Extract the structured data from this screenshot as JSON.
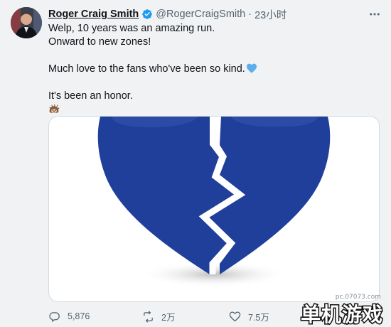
{
  "tweet": {
    "author": {
      "display_name": "Roger Craig Smith",
      "handle": "@RogerCraigSmith",
      "separator": "·",
      "time": "23小时",
      "verified": true
    },
    "more_icon": "more-horizontal-icon",
    "lines": [
      "Welp, 10 years was an amazing run.",
      "Onward to new zones!",
      "",
      "Much love to the fans who've been so kind.",
      "",
      "It's been an honor."
    ],
    "emoji_end": "hedgehog",
    "media": {
      "description_icon": "broken-heart-image",
      "heart_color": "#1f3f9a"
    },
    "actions": {
      "reply": {
        "icon": "reply-icon",
        "count": "5,876"
      },
      "retweet": {
        "icon": "retweet-icon",
        "count": "2万"
      },
      "like": {
        "icon": "heart-icon",
        "count": "7.5万"
      }
    }
  },
  "watermark": {
    "url": "pc.07073.com",
    "brand": "单机游戏"
  },
  "colors": {
    "background": "#f1f2f3",
    "text": "#0f1419",
    "secondary": "#536471",
    "verified_blue": "#1d9bf0",
    "heart_blue": "#1f3f9a"
  }
}
